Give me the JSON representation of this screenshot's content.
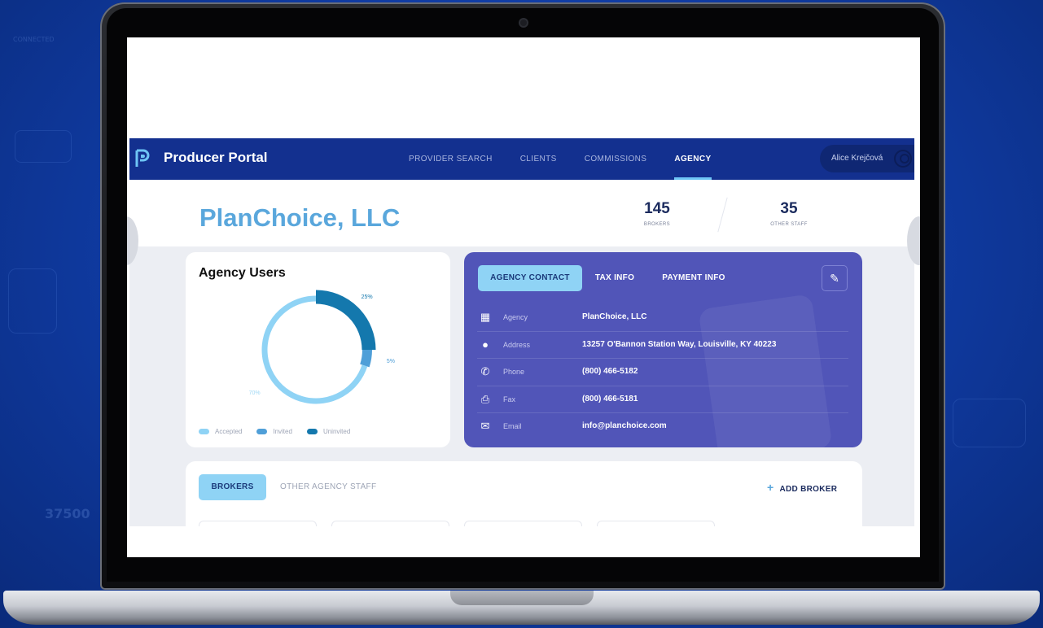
{
  "background": {
    "deco_texts": [
      "CONNECTED",
      "37500"
    ]
  },
  "nav": {
    "app_title": "Producer Portal",
    "links": [
      {
        "label": "PROVIDER SEARCH",
        "active": false
      },
      {
        "label": "CLIENTS",
        "active": false
      },
      {
        "label": "COMMISSIONS",
        "active": false
      },
      {
        "label": "AGENCY",
        "active": true
      }
    ],
    "user_name": "Alice Krejčová",
    "icons": [
      "logo-icon",
      "user-avatar-icon"
    ]
  },
  "header": {
    "company": "PlanChoice, LLC",
    "stats": [
      {
        "value": "145",
        "label": "BROKERS"
      },
      {
        "value": "35",
        "label": "OTHER STAFF"
      }
    ]
  },
  "agency_users": {
    "title": "Agency Users",
    "segments": [
      {
        "label": "Accepted",
        "percent_label": "70%",
        "value": 70,
        "color": "#8fd3f5"
      },
      {
        "label": "Invited",
        "percent_label": "5%",
        "value": 5,
        "color": "#4f9fd8"
      },
      {
        "label": "Uninvited",
        "percent_label": "25%",
        "value": 25,
        "color": "#1478ad"
      }
    ]
  },
  "contact": {
    "tabs": [
      {
        "label": "AGENCY CONTACT",
        "active": true
      },
      {
        "label": "TAX INFO",
        "active": false
      },
      {
        "label": "PAYMENT INFO",
        "active": false
      }
    ],
    "rows": [
      {
        "icon": "building-icon",
        "label": "Agency",
        "value": "PlanChoice, LLC"
      },
      {
        "icon": "location-pin-icon",
        "label": "Address",
        "value": "13257 O'Bannon Station Way, Louisville, KY 40223"
      },
      {
        "icon": "phone-icon",
        "label": "Phone",
        "value": "(800) 466-5182"
      },
      {
        "icon": "printer-icon",
        "label": "Fax",
        "value": "(800) 466-5181"
      },
      {
        "icon": "mail-icon",
        "label": "Email",
        "value": "info@planchoice.com"
      }
    ]
  },
  "brokers": {
    "tabs": [
      {
        "label": "BROKERS",
        "active": true
      },
      {
        "label": "OTHER AGENCY STAFF",
        "active": false
      }
    ],
    "add_label": "ADD BROKER"
  }
}
